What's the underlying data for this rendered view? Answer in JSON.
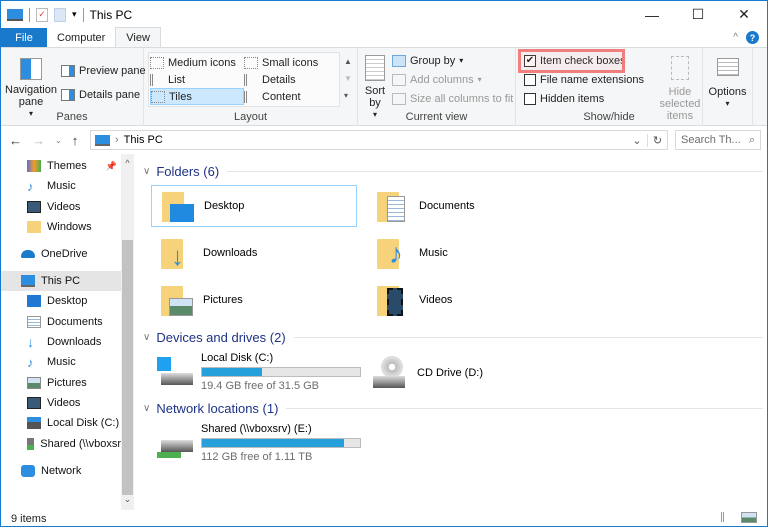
{
  "window": {
    "title": "This PC",
    "controls": [
      "minimize",
      "maximize",
      "close"
    ]
  },
  "ribbon_tabs": [
    {
      "label": "File"
    },
    {
      "label": "Computer"
    },
    {
      "label": "View"
    }
  ],
  "ribbon": {
    "panes": {
      "label": "Panes",
      "navigation_pane": "Navigation pane",
      "preview_pane": "Preview pane",
      "details_pane": "Details pane"
    },
    "layout": {
      "label": "Layout",
      "items": [
        "Medium icons",
        "Small icons",
        "List",
        "Details",
        "Tiles",
        "Content"
      ],
      "selected": "Tiles"
    },
    "current_view": {
      "label": "Current view",
      "sort_by": "Sort by",
      "group_by": "Group by",
      "add_columns": "Add columns",
      "size_columns": "Size all columns to fit"
    },
    "show_hide": {
      "label": "Show/hide",
      "item_check_boxes": "Item check boxes",
      "item_check_boxes_checked": true,
      "file_name_extensions": "File name extensions",
      "file_name_extensions_checked": false,
      "hidden_items": "Hidden items",
      "hidden_items_checked": false,
      "hide_selected": "Hide selected items"
    },
    "options": {
      "label": "Options"
    }
  },
  "address": {
    "path": "This PC",
    "search_placeholder": "Search Th..."
  },
  "nav_pane": {
    "items": [
      {
        "label": "Themes",
        "icon": "themes-icon",
        "pinned": true
      },
      {
        "label": "Music",
        "icon": "music-icon"
      },
      {
        "label": "Videos",
        "icon": "videos-icon"
      },
      {
        "label": "Windows",
        "icon": "folder-icon"
      },
      {
        "label": "OneDrive",
        "icon": "onedrive-icon"
      },
      {
        "label": "This PC",
        "icon": "this-pc-icon",
        "selected": true
      },
      {
        "label": "Desktop",
        "icon": "desktop-icon"
      },
      {
        "label": "Documents",
        "icon": "documents-icon"
      },
      {
        "label": "Downloads",
        "icon": "downloads-icon"
      },
      {
        "label": "Music",
        "icon": "music-icon"
      },
      {
        "label": "Pictures",
        "icon": "pictures-icon"
      },
      {
        "label": "Videos",
        "icon": "videos-icon"
      },
      {
        "label": "Local Disk (C:)",
        "icon": "local-disk-icon"
      },
      {
        "label": "Shared (\\\\vboxsr",
        "icon": "network-drive-icon"
      },
      {
        "label": "Network",
        "icon": "network-icon"
      }
    ]
  },
  "content": {
    "folders_header": "Folders (6)",
    "folders": [
      {
        "label": "Desktop"
      },
      {
        "label": "Documents"
      },
      {
        "label": "Downloads"
      },
      {
        "label": "Music"
      },
      {
        "label": "Pictures"
      },
      {
        "label": "Videos"
      }
    ],
    "devices_header": "Devices and drives (2)",
    "drives": [
      {
        "label": "Local Disk (C:)",
        "free": "19.4 GB free of 31.5 GB",
        "used_fraction": 0.38
      },
      {
        "label": "CD Drive (D:)"
      }
    ],
    "network_header": "Network locations (1)",
    "network": [
      {
        "label": "Shared (\\\\vboxsrv) (E:)",
        "free": "112 GB free of 1.11 TB",
        "used_fraction": 0.9
      }
    ]
  },
  "status": {
    "items": "9 items"
  },
  "colors": {
    "accent": "#1979ca",
    "highlight": "#f08080",
    "bar": "#26a0da",
    "section": "#1e3287"
  }
}
